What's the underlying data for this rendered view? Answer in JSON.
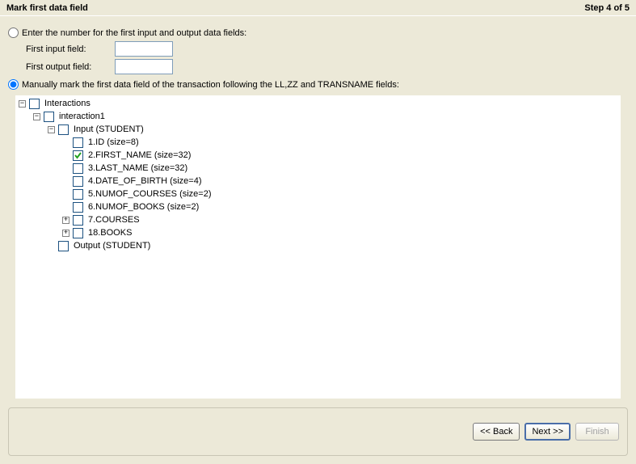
{
  "header": {
    "title": "Mark first data field",
    "step": "Step 4 of 5"
  },
  "options": {
    "enter_number": {
      "label": "Enter the number for the first input and output data fields:",
      "selected": false,
      "first_input_label": "First input field:",
      "first_input_value": "",
      "first_output_label": "First output field:",
      "first_output_value": ""
    },
    "manually_mark": {
      "label": "Manually mark the first data field of the transaction following the LL,ZZ and TRANSNAME fields:",
      "selected": true
    }
  },
  "tree": {
    "root": {
      "label": "Interactions",
      "expanded": true,
      "checked": false,
      "children": [
        {
          "label": "interaction1",
          "expanded": true,
          "checked": false,
          "children": [
            {
              "label": "Input (STUDENT)",
              "expanded": true,
              "checked": false,
              "children": [
                {
                  "label": "1.ID (size=8)",
                  "checked": false,
                  "leaf": true
                },
                {
                  "label": "2.FIRST_NAME (size=32)",
                  "checked": true,
                  "leaf": true
                },
                {
                  "label": "3.LAST_NAME (size=32)",
                  "checked": false,
                  "leaf": true
                },
                {
                  "label": "4.DATE_OF_BIRTH (size=4)",
                  "checked": false,
                  "leaf": true
                },
                {
                  "label": "5.NUMOF_COURSES (size=2)",
                  "checked": false,
                  "leaf": true
                },
                {
                  "label": "6.NUMOF_BOOKS (size=2)",
                  "checked": false,
                  "leaf": true
                },
                {
                  "label": "7.COURSES",
                  "checked": false,
                  "expanded": false,
                  "children": []
                },
                {
                  "label": "18.BOOKS",
                  "checked": false,
                  "expanded": false,
                  "children": []
                }
              ]
            },
            {
              "label": "Output (STUDENT)",
              "checked": false,
              "leaf": true
            }
          ]
        }
      ]
    }
  },
  "buttons": {
    "back": "<< Back",
    "next": "Next >>",
    "finish": "Finish"
  }
}
